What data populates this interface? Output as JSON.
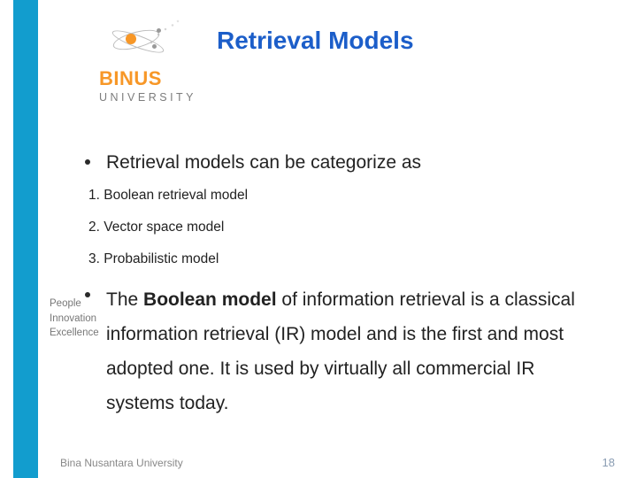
{
  "brand": {
    "name": "BINUS",
    "sub": "UNIVERSITY"
  },
  "title": "Retrieval Models",
  "watermark": {
    "l1": "People",
    "l2": "Innovation",
    "l3": "Excellence"
  },
  "bullet1": "Retrieval models can be categorize as",
  "numbered": [
    "1.  Boolean retrieval model",
    "2.  Vector space model",
    "3.  Probabilistic model"
  ],
  "para2": {
    "pre": "The ",
    "bold": "Boolean model",
    "post": " of information retrieval is a classical information retrieval (IR) model and is the first and most adopted one. It is used by virtually all commercial IR systems today."
  },
  "footer": {
    "left": "Bina Nusantara University",
    "right": "18"
  }
}
